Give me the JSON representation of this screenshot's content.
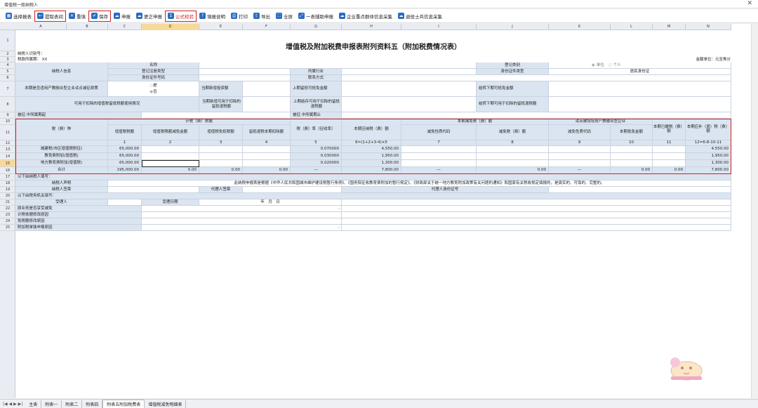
{
  "window": {
    "title": "增值税一般纳税人",
    "close": "✕"
  },
  "toolbar": [
    {
      "label": "选择报表",
      "icon": "grid-icon",
      "color": "#2b6cc4"
    },
    {
      "label": "提取表间",
      "icon": "extract-icon",
      "color": "#2b6cc4",
      "highlight": true
    },
    {
      "label": "重填",
      "icon": "reset-icon",
      "color": "#2b6cc4"
    },
    {
      "label": "保存",
      "icon": "save-icon",
      "color": "#2b6cc4",
      "highlight": true
    },
    {
      "label": "申报",
      "icon": "cloud-upload-icon",
      "color": "#2b6cc4"
    },
    {
      "label": "更正申报",
      "icon": "cloud-edit-icon",
      "color": "#2b6cc4"
    },
    {
      "label": "公式校验",
      "icon": "formula-icon",
      "color": "#2b6cc4",
      "boxed": true
    },
    {
      "label": "填报说明",
      "icon": "help-icon",
      "color": "#2b6cc4"
    },
    {
      "label": "打印",
      "icon": "print-icon",
      "color": "#2b6cc4"
    },
    {
      "label": "导出",
      "icon": "export-icon",
      "color": "#2b6cc4"
    },
    {
      "label": "全屏",
      "icon": "fullscreen-icon",
      "color": "#2b6cc4"
    },
    {
      "label": "一表辅助申报",
      "icon": "expand-icon",
      "color": "#2b6cc4"
    },
    {
      "label": "企业重点群体信息采集",
      "icon": "cloud-icon",
      "color": "#2b6cc4"
    },
    {
      "label": "退役士兵信息采集",
      "icon": "cloud-icon",
      "color": "#2b6cc4"
    }
  ],
  "columns": [
    "A",
    "B",
    "C",
    "D",
    "E",
    "F",
    "G",
    "H",
    "I",
    "J",
    "K",
    "L",
    "M",
    "N"
  ],
  "rows": [
    "1",
    "2",
    "3",
    "4",
    "5",
    "6",
    "7",
    "8",
    "9",
    "10",
    "11",
    "12",
    "13",
    "14",
    "15",
    "16",
    "17",
    "18",
    "19",
    "20",
    "21",
    "22",
    "23",
    "24",
    "25"
  ],
  "sheet": {
    "title": "增值税及附加税费申报表附列资料五（附加税费情况表）",
    "taxpayer_id_label": "纳税人识别号：",
    "period_label": "税款所属期： XX",
    "unit_label": "金额单位：元至角分",
    "taxpayer_info": "纳税人信息",
    "name": "名称",
    "reg_type": "登记注册类型",
    "id_no": "身份证件号码",
    "industry": "所属行业",
    "contact": "联系方式",
    "reg_category": "登记类别",
    "unit_opt": "单位",
    "person_opt": "个人",
    "id_type": "身份证件类型",
    "id_type_val": "居民身份证",
    "policy_q": "本期是否适用产教融合型企业试点减征政策",
    "yes": "是",
    "no": "否",
    "cur_invest": "当期新增投资额",
    "prev_carry": "上期留抵可抵免金额",
    "carry_next": "结转下期可抵免金额",
    "refund_usage": "可用于扣除的增值税留抵税额使用情况",
    "cur_new_refund": "当期新增可用于扣除的留抵退税额",
    "prev_refund": "上期结存可用于扣除的留抵退税额",
    "next_refund": "结转下期可用于扣除的留抵退税额",
    "mid_start": "被征.中所属期起",
    "mid_end": "被征.中所属期止",
    "basis": "计税（费）依据",
    "tax_item": "税（费）种",
    "vat_amt": "增值税税额",
    "vat_exempt": "增值税限额减免金额",
    "vat_free": "增值税免抵税额",
    "refund_deduct": "留抵退税本期扣除额",
    "rate": "税（费）率（征收率）",
    "due": "本期应纳税（费）额",
    "reduce": "本期减免税（费）额",
    "reduce_code": "减免性质代码",
    "reduce_amt": "减免税（费）额",
    "pilot": "试点建设培育产教融合型企业",
    "pilot_code": "减免性质代码",
    "pilot_amt": "本期抵免金额",
    "paid": "本期已缴税（费）额",
    "payable": "本期应补（退）税（费）额",
    "idx": [
      "1",
      "2",
      "3",
      "4",
      "5",
      "6=(1+2+3-4)×5",
      "7",
      "8",
      "9",
      "10",
      "11",
      "12=6-8-10-11"
    ],
    "data": [
      {
        "name": "城建税(市区增值税附征)",
        "vat": "65,000.00",
        "rate": "0.070000",
        "due": "4,550.00",
        "pay": "4,550.00"
      },
      {
        "name": "教育费附加(增值税)",
        "vat": "65,000.00",
        "rate": "0.030000",
        "due": "1,950.00",
        "pay": "1,950.00"
      },
      {
        "name": "地方教育费附加(增值税)",
        "vat": "65,000.00",
        "rate": "0.020000",
        "due": "1,300.00",
        "pay": "1,300.00"
      }
    ],
    "total": {
      "label": "合计",
      "vat": "195,000.00",
      "c2": "0.00",
      "c3": "0.00",
      "c4": "0.00",
      "rate": "—",
      "due": "7,800.00",
      "c7": "—",
      "c8": "0.00",
      "c9": "—",
      "c10": "0.00",
      "c11": "0.00",
      "pay": "7,800.00"
    },
    "r17": "以下由纳税人填写：",
    "r18a": "纳税人声明",
    "r18b": "此纳税申报表是根据《中华人民共和国城市维护建设税暂行条例》、《国务院征收教育费附加的暂行规定》、《财政部关于统一地方教育附加政策有关问题的通知》和国家有关税收规定填报的，是真实的、可靠的、完整的。",
    "r19a": "纳税人签章",
    "r19b": "代理人签章",
    "r19c": "代理人身份证号",
    "r20": "以下由税务机关填写：",
    "r21a": "受理人",
    "r21b": "受理日期",
    "r21c": "年　月　日",
    "r22": "原业务是否享受减免",
    "r23": "计税依据修改原因",
    "r24": "免税额修改原因",
    "r25": "附加税单独申报原因"
  },
  "tabs": [
    "主表",
    "附表一",
    "附表二",
    "附表四",
    "附表五附加税费表",
    "增值税减免明细表"
  ],
  "active_tab": "附表五附加税费表",
  "nav": "|◀ ◀ ▶ ▶|"
}
